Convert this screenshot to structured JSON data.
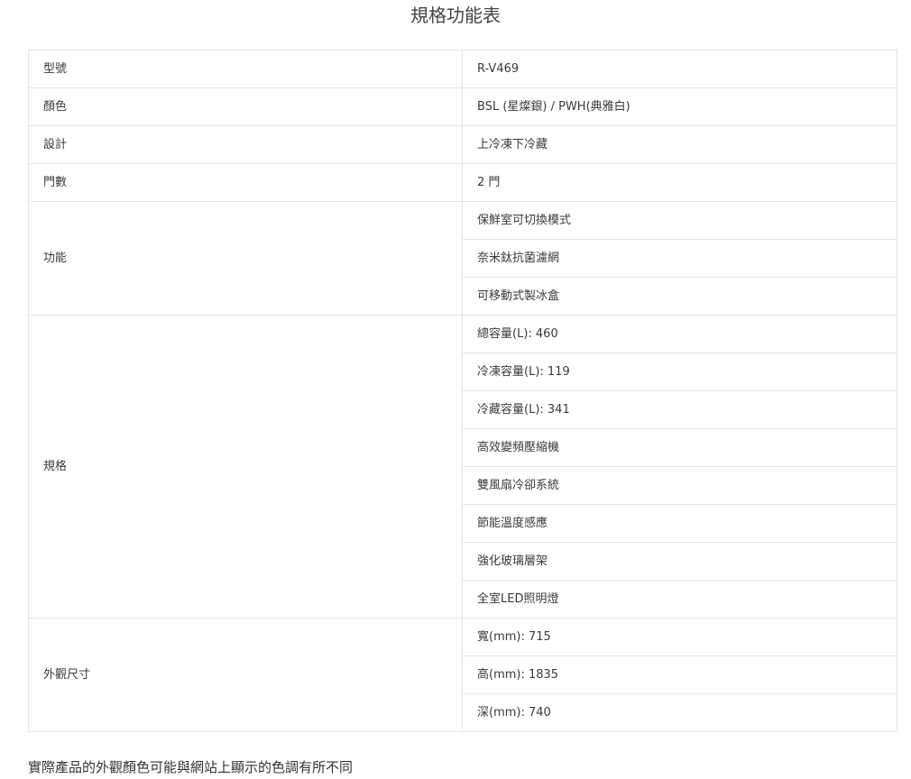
{
  "title": "規格功能表",
  "rows": [
    {
      "label": "型號",
      "values": [
        "R-V469"
      ]
    },
    {
      "label": "顏色",
      "values": [
        "BSL (星燦銀) / PWH(典雅白)"
      ]
    },
    {
      "label": "設計",
      "values": [
        "上冷凍下冷藏"
      ]
    },
    {
      "label": "門數",
      "values": [
        "2 門"
      ]
    },
    {
      "label": "功能",
      "values": [
        "保鮮室可切換模式",
        "奈米鈦抗菌濾網",
        "可移動式製冰盒"
      ]
    },
    {
      "label": "規格",
      "values": [
        "總容量(L): 460",
        "冷凍容量(L): 119",
        "冷藏容量(L): 341",
        "高效變頻壓縮機",
        "雙風扇冷卻系統",
        "節能溫度感應",
        "強化玻璃層架",
        "全室LED照明燈"
      ]
    },
    {
      "label": "外觀尺寸",
      "values": [
        "寬(mm): 715",
        "高(mm): 1835",
        "深(mm): 740"
      ]
    }
  ],
  "footnote": "實際產品的外觀顏色可能與網站上顯示的色調有所不同"
}
